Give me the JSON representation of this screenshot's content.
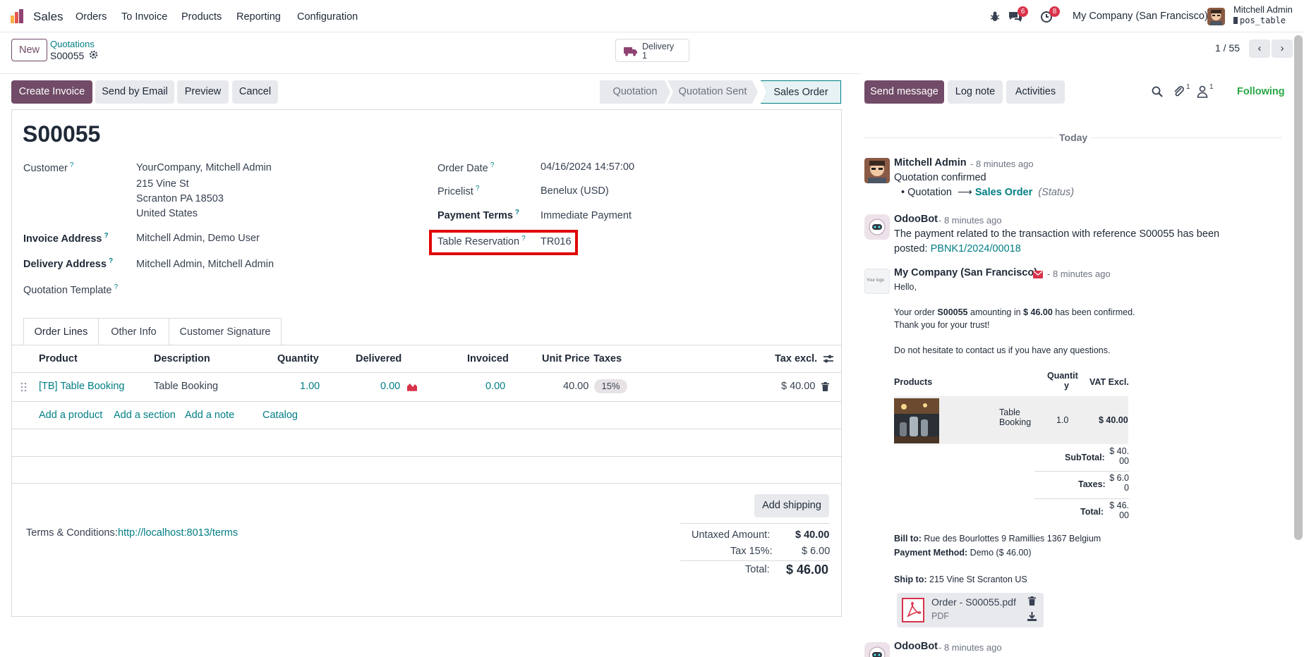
{
  "navbar": {
    "app_name": "Sales",
    "menus": [
      "Orders",
      "To Invoice",
      "Products",
      "Reporting",
      "Configuration"
    ],
    "messages_badge": "6",
    "activities_badge": "8",
    "company": "My Company (San Francisco)",
    "user_name": "Mitchell Admin",
    "db_name": "pos_table"
  },
  "control": {
    "new_label": "New",
    "breadcrumb_parent": "Quotations",
    "breadcrumb_current": "S00055",
    "smart_delivery_label": "Delivery",
    "smart_delivery_count": "1",
    "pager": "1 / 55"
  },
  "actions": {
    "create_invoice": "Create Invoice",
    "send_by_email": "Send by Email",
    "preview": "Preview",
    "cancel": "Cancel"
  },
  "status": {
    "steps": [
      "Quotation",
      "Quotation Sent",
      "Sales Order"
    ],
    "active_index": 2
  },
  "form": {
    "title": "S00055",
    "customer_label": "Customer",
    "customer_name": "YourCompany, Mitchell Admin",
    "customer_addr1": "215 Vine St",
    "customer_addr2": "Scranton PA 18503",
    "customer_addr3": "United States",
    "invoice_address_label": "Invoice Address",
    "invoice_address": "Mitchell Admin, Demo User",
    "delivery_address_label": "Delivery Address",
    "delivery_address": "Mitchell Admin, Mitchell Admin",
    "quotation_template_label": "Quotation Template",
    "order_date_label": "Order Date",
    "order_date": "04/16/2024 14:57:00",
    "pricelist_label": "Pricelist",
    "pricelist": "Benelux (USD)",
    "payment_terms_label": "Payment Terms",
    "payment_terms": "Immediate Payment",
    "table_reservation_label": "Table Reservation",
    "table_reservation": "TR016",
    "help_mark": "?"
  },
  "tabs": [
    "Order Lines",
    "Other Info",
    "Customer Signature"
  ],
  "lines": {
    "headers": {
      "product": "Product",
      "description": "Description",
      "quantity": "Quantity",
      "delivered": "Delivered",
      "invoiced": "Invoiced",
      "unit_price": "Unit Price",
      "taxes": "Taxes",
      "tax_excl": "Tax excl."
    },
    "rows": [
      {
        "product": "[TB] Table Booking",
        "description": "Table Booking",
        "quantity": "1.00",
        "delivered": "0.00",
        "invoiced": "0.00",
        "unit_price": "40.00",
        "taxes": "15%",
        "subtotal": "$ 40.00"
      }
    ],
    "add_product": "Add a product",
    "add_section": "Add a section",
    "add_note": "Add a note",
    "catalog": "Catalog"
  },
  "footer": {
    "add_shipping": "Add shipping",
    "terms_label": "Terms & Conditions:",
    "terms_link": "http://localhost:8013/terms",
    "untaxed_label": "Untaxed Amount:",
    "untaxed_value": "$ 40.00",
    "tax_label": "Tax 15%:",
    "tax_value": "$ 6.00",
    "total_label": "Total:",
    "total_value": "$ 46.00"
  },
  "chatter": {
    "send_message": "Send message",
    "log_note": "Log note",
    "activities": "Activities",
    "attachments_count": "1",
    "followers_count": "1",
    "following": "Following",
    "today": "Today",
    "msg1": {
      "author": "Mitchell Admin",
      "time": "- 8 minutes ago",
      "body": "Quotation confirmed",
      "from": "Quotation",
      "arrow": "⟶",
      "to": "Sales Order",
      "field": "(Status)"
    },
    "msg2": {
      "author": "OdooBot",
      "time": "- 8 minutes ago",
      "body_line1": "The payment related to the transaction with reference S00055 has been",
      "body_line2_prefix": "posted:",
      "link": "PBNK1/2024/00018"
    },
    "msg3": {
      "author": "My Company (San Francisco)",
      "time": "- 8 minutes ago",
      "logo_text": "Your logo",
      "hello": "Hello,",
      "line1_a": "Your order",
      "line1_order": "S00055",
      "line1_b": "amounting in",
      "line1_amount": "$ 46.00",
      "line1_c": "has been confirmed.",
      "line2": "Thank you for your trust!",
      "line3": "Do not hesitate to contact us if you have any questions.",
      "products_header": "Products",
      "qty_header_1": "Quantit",
      "qty_header_2": "y",
      "vat_header": "VAT Excl.",
      "product_name_1": "Table",
      "product_name_2": "Booking",
      "product_qty": "1.0",
      "product_price": "$ 40.00",
      "subtotal_label": "SubTotal:",
      "subtotal_1": "$ 40.",
      "subtotal_2": "00",
      "taxes_label": "Taxes:",
      "taxes_1": "$ 6.0",
      "taxes_2": "0",
      "total_label": "Total:",
      "total_1": "$ 46.",
      "total_2": "00",
      "bill_to_label": "Bill to:",
      "bill_to": "Rue des Bourlottes 9 Ramillies 1367 Belgium",
      "payment_method_label": "Payment Method:",
      "payment_method": "Demo ($ 46.00)",
      "ship_to_label": "Ship to:",
      "ship_to": "215 Vine St Scranton US",
      "attachment_name": "Order - S00055.pdf",
      "attachment_type": "PDF"
    },
    "msg4": {
      "author": "OdooBot",
      "time": "- 8 minutes ago"
    }
  },
  "colors": {
    "primary": "#714b67",
    "link": "#017e84",
    "highlight": "#e10600",
    "following": "#28a745",
    "badge": "#d9324a"
  }
}
